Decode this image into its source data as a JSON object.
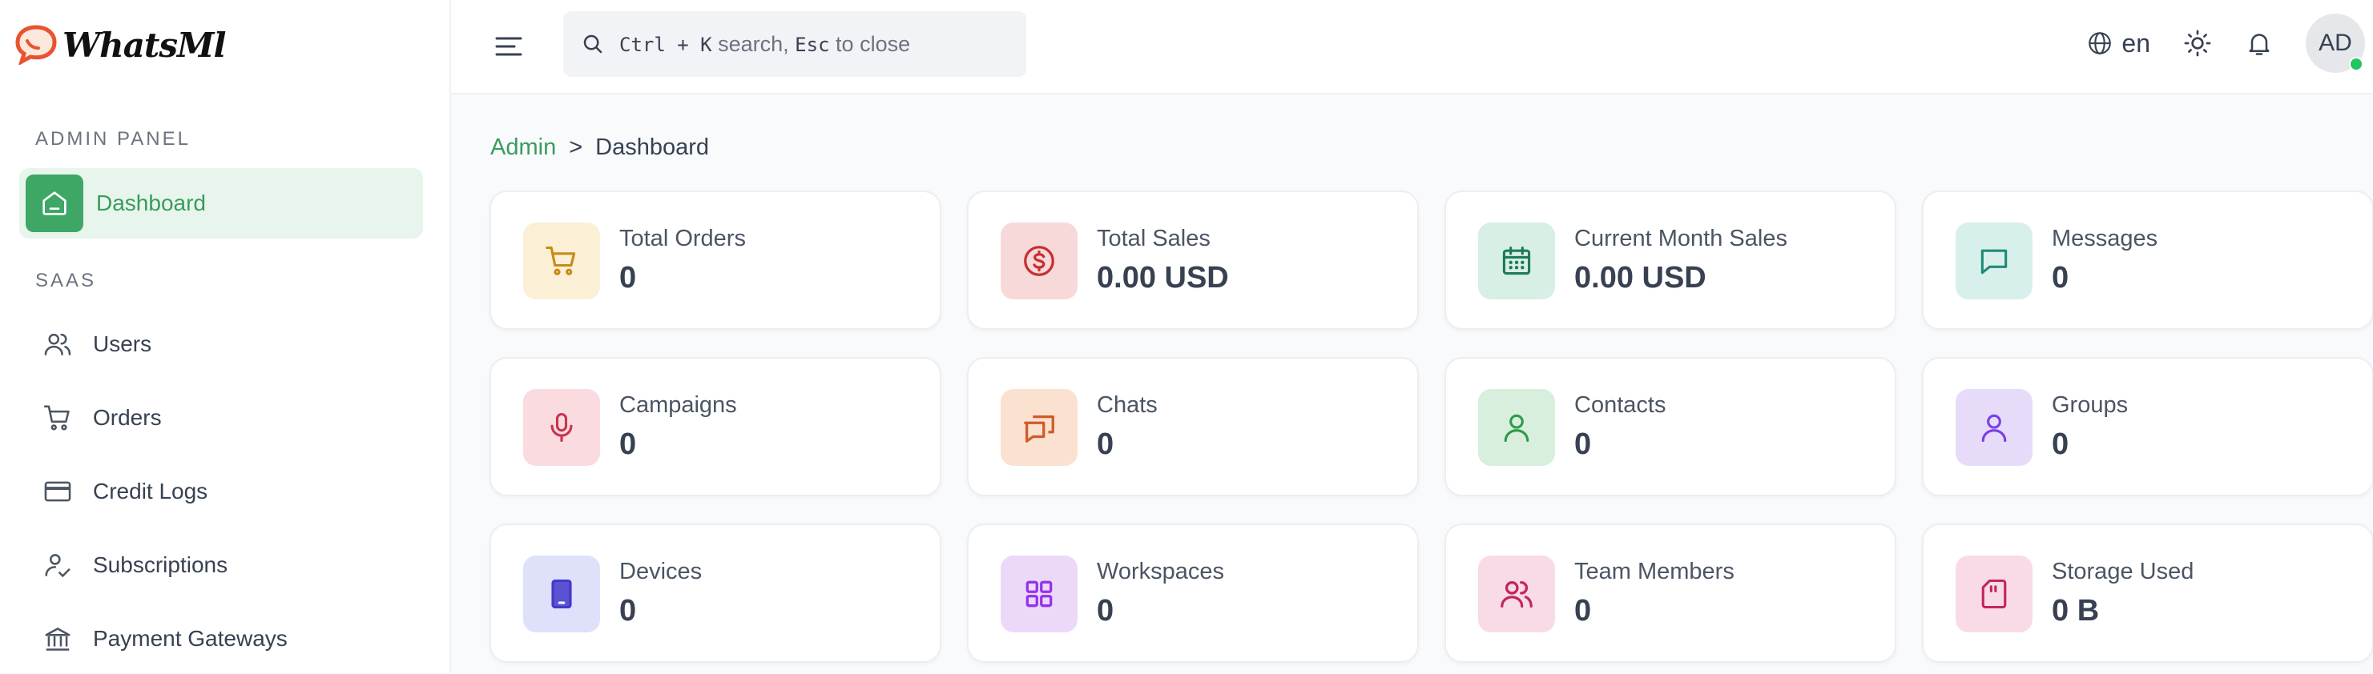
{
  "brand": {
    "name": "WhatsMl"
  },
  "sidebar": {
    "admin_section": "ADMIN PANEL",
    "saas_section": "SAAS",
    "items": [
      {
        "label": "Dashboard",
        "icon": "home-icon"
      },
      {
        "label": "Users",
        "icon": "users-icon"
      },
      {
        "label": "Orders",
        "icon": "cart-icon"
      },
      {
        "label": "Credit Logs",
        "icon": "credit-card-icon"
      },
      {
        "label": "Subscriptions",
        "icon": "user-check-icon"
      },
      {
        "label": "Payment Gateways",
        "icon": "bank-icon"
      }
    ]
  },
  "topbar": {
    "search": {
      "kbd1": "Ctrl + K",
      "text1": "search,",
      "kbd2": "Esc",
      "text2": "to close"
    },
    "language": "en",
    "avatar_initials": "AD"
  },
  "breadcrumb": {
    "root": "Admin",
    "separator": ">",
    "current": "Dashboard"
  },
  "colors": {
    "accent": "#3a9b5d",
    "active_bg": "#e8f5ec"
  },
  "stats": [
    {
      "label": "Total Orders",
      "value": "0",
      "icon": "cart-icon"
    },
    {
      "label": "Total Sales",
      "value": "0.00 USD",
      "icon": "dollar-circle-icon"
    },
    {
      "label": "Current Month Sales",
      "value": "0.00 USD",
      "icon": "calendar-icon"
    },
    {
      "label": "Messages",
      "value": "0",
      "icon": "message-icon"
    },
    {
      "label": "Campaigns",
      "value": "0",
      "icon": "microphone-icon"
    },
    {
      "label": "Chats",
      "value": "0",
      "icon": "chats-icon"
    },
    {
      "label": "Contacts",
      "value": "0",
      "icon": "contact-icon"
    },
    {
      "label": "Groups",
      "value": "0",
      "icon": "group-icon"
    },
    {
      "label": "Devices",
      "value": "0",
      "icon": "device-icon"
    },
    {
      "label": "Workspaces",
      "value": "0",
      "icon": "workspaces-icon"
    },
    {
      "label": "Team Members",
      "value": "0",
      "icon": "team-members-icon"
    },
    {
      "label": "Storage Used",
      "value": "0 B",
      "icon": "storage-icon"
    }
  ]
}
